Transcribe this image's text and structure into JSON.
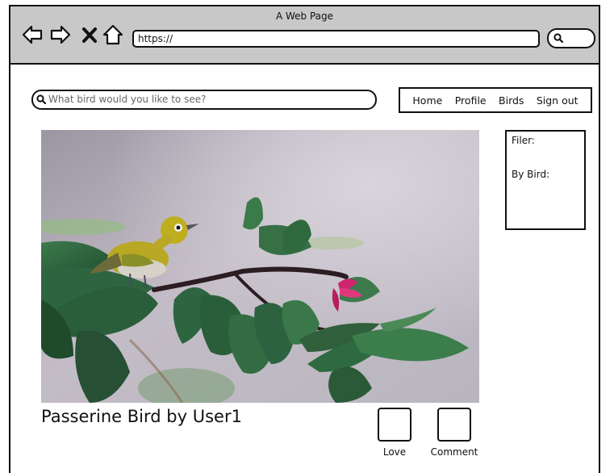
{
  "browser": {
    "title": "A Web Page",
    "url": "https://",
    "icons": {
      "back": "back-arrow-icon",
      "forward": "forward-arrow-icon",
      "stop": "close-icon",
      "home": "home-icon",
      "search": "search-icon"
    }
  },
  "search": {
    "placeholder": "What bird would you like to see?",
    "value": ""
  },
  "nav": {
    "items": [
      {
        "label": "Home"
      },
      {
        "label": "Profile"
      },
      {
        "label": "Birds"
      },
      {
        "label": "Sign out"
      }
    ]
  },
  "filter": {
    "title": "Filer:",
    "by_bird": "By Bird:"
  },
  "post": {
    "title": "Passerine Bird by User1",
    "love_label": "Love",
    "comment_label": "Comment"
  },
  "colors": {
    "titlebar": "#c8c8c8",
    "outline": "#111111",
    "bird_body": "#b8a823",
    "flower": "#d1246e",
    "leaf": "#2f6b3f"
  }
}
